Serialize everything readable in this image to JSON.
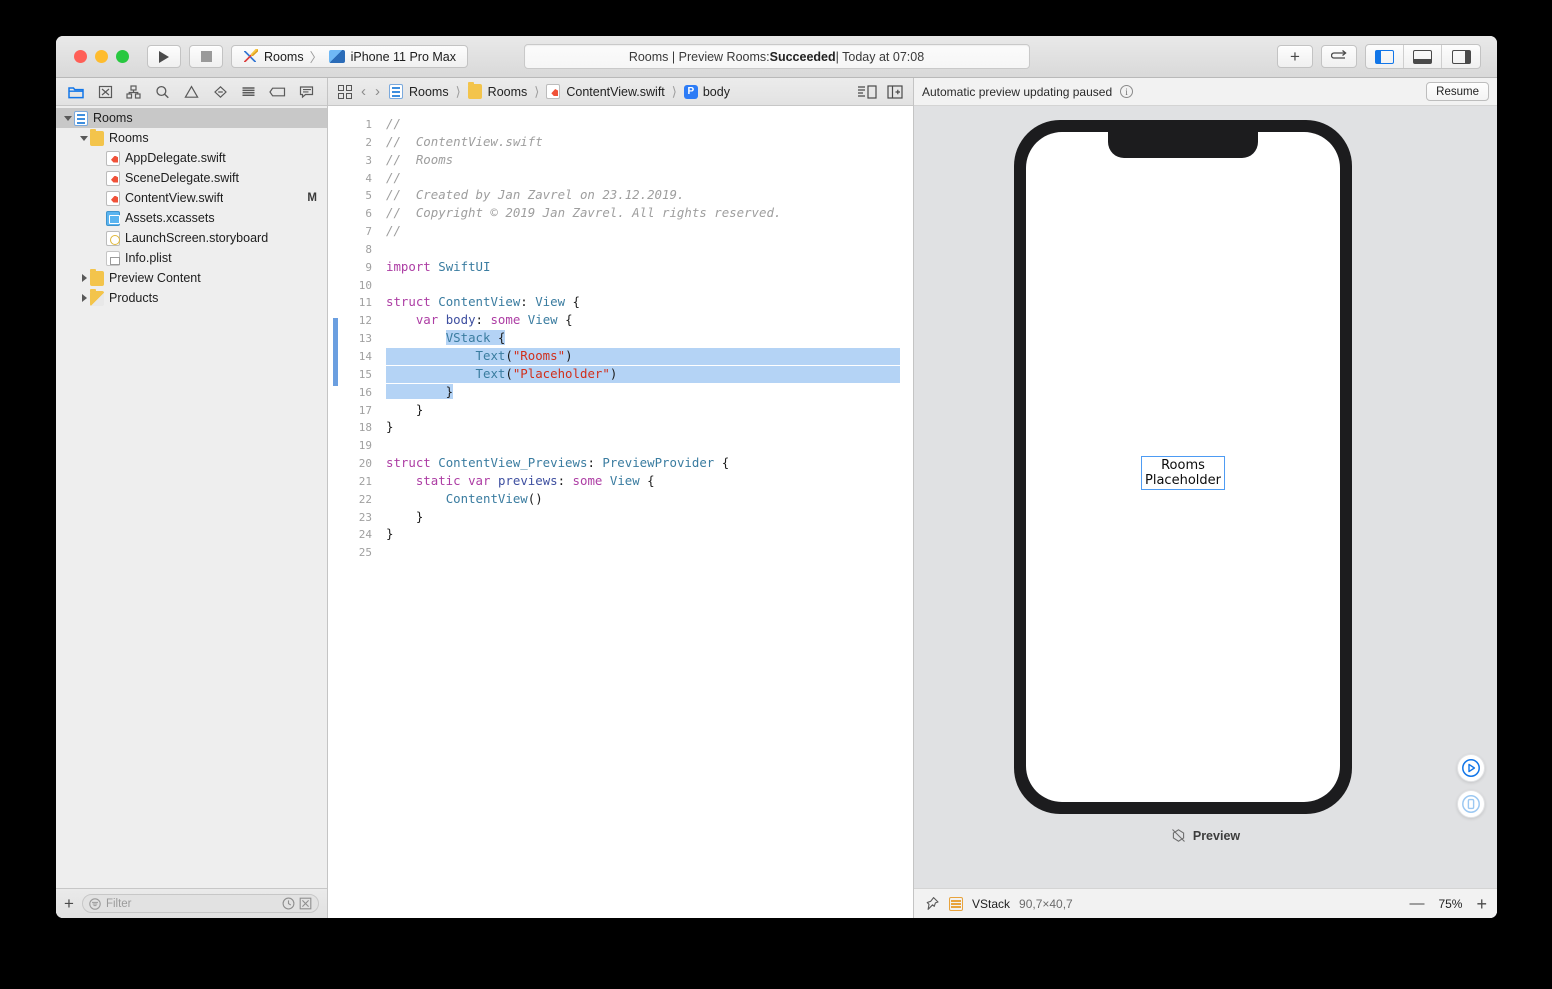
{
  "titlebar": {
    "scheme_project": "Rooms",
    "scheme_sep": "〉",
    "scheme_device": "iPhone 11 Pro Max",
    "status_prefix": "Rooms | Preview Rooms: ",
    "status_bold": "Succeeded",
    "status_suffix": " | Today at 07:08",
    "run_button_name": "Run",
    "stop_button_name": "Stop",
    "add_button_label": "+",
    "navigate_button_label": "⇄"
  },
  "navigator": {
    "toolbar_icons": [
      "project-navigator-icon",
      "source-control-navigator-icon",
      "symbol-navigator-icon",
      "find-navigator-icon",
      "issue-navigator-icon",
      "test-navigator-icon",
      "debug-navigator-icon",
      "breakpoint-navigator-icon",
      "report-navigator-icon"
    ],
    "tree": [
      {
        "label": "Rooms",
        "icon": "project-icon",
        "indent": 0,
        "twisty": "open",
        "selected": true,
        "badge": ""
      },
      {
        "label": "Rooms",
        "icon": "folder-icon",
        "indent": 1,
        "twisty": "open",
        "selected": false,
        "badge": ""
      },
      {
        "label": "AppDelegate.swift",
        "icon": "swift-file-icon",
        "indent": 2,
        "twisty": "none",
        "selected": false,
        "badge": ""
      },
      {
        "label": "SceneDelegate.swift",
        "icon": "swift-file-icon",
        "indent": 2,
        "twisty": "none",
        "selected": false,
        "badge": ""
      },
      {
        "label": "ContentView.swift",
        "icon": "swift-file-icon",
        "indent": 2,
        "twisty": "none",
        "selected": false,
        "badge": "M"
      },
      {
        "label": "Assets.xcassets",
        "icon": "assets-icon",
        "indent": 2,
        "twisty": "none",
        "selected": false,
        "badge": ""
      },
      {
        "label": "LaunchScreen.storyboard",
        "icon": "storyboard-icon",
        "indent": 2,
        "twisty": "none",
        "selected": false,
        "badge": ""
      },
      {
        "label": "Info.plist",
        "icon": "plist-icon",
        "indent": 2,
        "twisty": "none",
        "selected": false,
        "badge": ""
      },
      {
        "label": "Preview Content",
        "icon": "folder-icon",
        "indent": 1,
        "twisty": "closed",
        "selected": false,
        "badge": ""
      },
      {
        "label": "Products",
        "icon": "products-folder-icon",
        "indent": 1,
        "twisty": "closed",
        "selected": false,
        "badge": ""
      }
    ],
    "add_button_label": "+",
    "filter_placeholder": "Filter"
  },
  "jumpbar": {
    "crumbs": [
      {
        "label": "Rooms",
        "icon": "project-icon"
      },
      {
        "label": "Rooms",
        "icon": "folder-icon"
      },
      {
        "label": "ContentView.swift",
        "icon": "swift-file-icon"
      },
      {
        "label": "body",
        "icon": "property-icon"
      }
    ],
    "property_badge": "P"
  },
  "editor": {
    "first_line": 1,
    "total_lines": 25,
    "selection_start_line": 13,
    "selection_end_line": 16,
    "lines": [
      {
        "n": 1,
        "text": "//"
      },
      {
        "n": 2,
        "text": "//  ContentView.swift"
      },
      {
        "n": 3,
        "text": "//  Rooms"
      },
      {
        "n": 4,
        "text": "//"
      },
      {
        "n": 5,
        "text": "//  Created by Jan Zavrel on 23.12.2019."
      },
      {
        "n": 6,
        "text": "//  Copyright © 2019 Jan Zavrel. All rights reserved."
      },
      {
        "n": 7,
        "text": "//"
      },
      {
        "n": 8,
        "text": ""
      },
      {
        "n": 9,
        "text": "import SwiftUI"
      },
      {
        "n": 10,
        "text": ""
      },
      {
        "n": 11,
        "text": "struct ContentView: View {"
      },
      {
        "n": 12,
        "text": "    var body: some View {"
      },
      {
        "n": 13,
        "text": "        VStack {"
      },
      {
        "n": 14,
        "text": "            Text(\"Rooms\")"
      },
      {
        "n": 15,
        "text": "            Text(\"Placeholder\")"
      },
      {
        "n": 16,
        "text": "        }"
      },
      {
        "n": 17,
        "text": "    }"
      },
      {
        "n": 18,
        "text": "}"
      },
      {
        "n": 19,
        "text": ""
      },
      {
        "n": 20,
        "text": "struct ContentView_Previews: PreviewProvider {"
      },
      {
        "n": 21,
        "text": "    static var previews: some View {"
      },
      {
        "n": 22,
        "text": "        ContentView()"
      },
      {
        "n": 23,
        "text": "    }"
      },
      {
        "n": 24,
        "text": "}"
      },
      {
        "n": 25,
        "text": ""
      }
    ]
  },
  "canvas": {
    "paused_message": "Automatic preview updating paused",
    "resume_label": "Resume",
    "device_name": "iPhone 11 Pro Max",
    "preview_text_1": "Rooms",
    "preview_text_2": "Placeholder",
    "preview_label": "Preview",
    "selected_view": "VStack",
    "selected_dimensions": "90,7×40,7",
    "zoom_level": "75%",
    "zoom_out_label": "—",
    "zoom_in_label": "+",
    "live_preview_icon": "play-circle-icon",
    "device_preview_icon": "device-circle-icon",
    "pin_icon": "pin-icon"
  },
  "colors": {
    "accent": "#1276e8",
    "selection": "#b4d3f5",
    "change_bar": "#6b9fe0",
    "swift_orange": "#f05138",
    "vstack_orange": "#e8a33d",
    "preview_border": "#4d9bf3",
    "device_body": "#1c1c1e",
    "canvas_bg": "#e0e1e3"
  }
}
